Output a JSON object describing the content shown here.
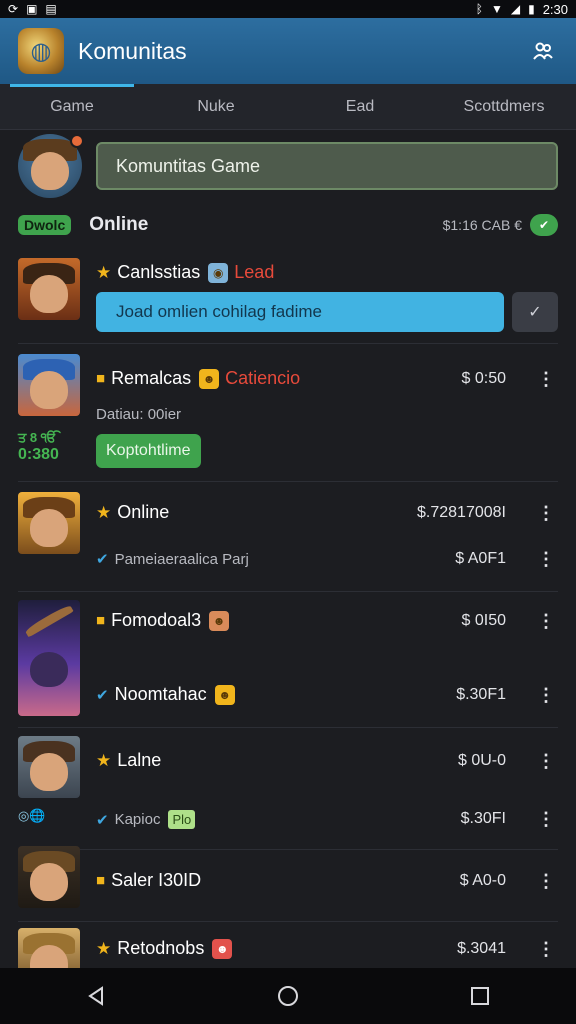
{
  "status_bar": {
    "left_icons": [
      "sync-icon",
      "gallery-icon",
      "photo-icon"
    ],
    "right_icons": [
      "bluetooth-icon",
      "wifi-icon",
      "signal-icon",
      "battery-icon"
    ],
    "time": "2:30"
  },
  "app_bar": {
    "title": "Komunitas",
    "logo_icon": "globe-logo-icon",
    "action_icon": "people-icon"
  },
  "tabs": [
    {
      "label": "Game",
      "active": true
    },
    {
      "label": "Nuke",
      "active": false
    },
    {
      "label": "Ead",
      "active": false
    },
    {
      "label": "Scottdmers",
      "active": false
    }
  ],
  "group": {
    "name_value": "Komuntitas Game"
  },
  "online": {
    "chip": "Dwolc",
    "label": "Online",
    "meta": "$1:16 CAB €",
    "toggle_icon": "check-icon"
  },
  "rows": [
    {
      "title": "Canlsstias",
      "title_icon": "star-icon",
      "badge_icon": "globe-emoji-icon",
      "accent": "Lead",
      "invite_text": "Joad omlien cohilag fadime",
      "invite_button_icon": "check-icon"
    },
    {
      "title": "Remalcas",
      "title_icon": "square-badge-icon",
      "badge_icon": "face-emoji-icon",
      "accent": "Catiencio",
      "price": "$ 0:50",
      "subtitle": "Datiau: 00ier",
      "side_stats": [
        "ਤ 8 ੴ",
        "0:380"
      ],
      "button_label": "Koptohtlime"
    },
    {
      "title": "Online",
      "title_icon": "star-icon",
      "price": "$.72817008I",
      "subtitle": "Pameiaeraalica Parj",
      "sub_price": "$ A0F1"
    },
    {
      "title": "Fomodoal3",
      "title_icon": "square-badge-icon",
      "badge_icon": "face-emoji-icon",
      "price": "$ 0I50",
      "subtitle": "Noomtahac",
      "sub_price": "$.30F1"
    },
    {
      "title": "Lalne",
      "title_icon": "star-icon",
      "price": "$ 0U-0",
      "subtitle": "Kapioc",
      "tag": "Plo",
      "sub_price": "$.30FI",
      "mini_icons": "◎🌐"
    },
    {
      "title": "Saler I30ID",
      "title_icon": "square-badge-icon",
      "price": "$ A0-0"
    },
    {
      "title": "Retodnobs",
      "title_icon": "star-icon",
      "badge_icon": "face-emoji-icon",
      "price": "$.3041"
    }
  ],
  "nav": [
    "back-icon",
    "home-icon",
    "recents-icon"
  ],
  "colors": {
    "appbar": "#2d6ea0",
    "accent_blue": "#41b3e2",
    "accent_green": "#3fa34d",
    "star": "#f1b51c",
    "background": "#1c1d21"
  }
}
